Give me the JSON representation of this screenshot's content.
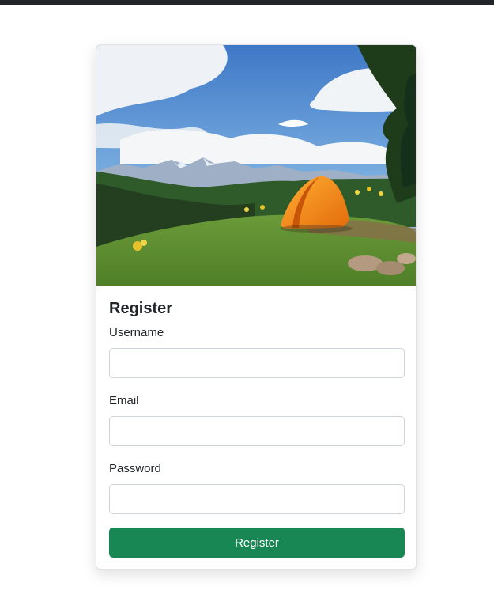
{
  "form": {
    "title": "Register",
    "fields": [
      {
        "label": "Username",
        "value": "",
        "placeholder": ""
      },
      {
        "label": "Email",
        "value": "",
        "placeholder": ""
      },
      {
        "label": "Password",
        "value": "",
        "placeholder": ""
      }
    ],
    "submit_label": "Register"
  },
  "hero": {
    "description": "camping tent on grassy hillside with mountains",
    "icon": "camping-photo"
  },
  "colors": {
    "top_bar": "#212529",
    "primary_button": "#198754",
    "input_border": "#ced4da",
    "text": "#212529"
  }
}
